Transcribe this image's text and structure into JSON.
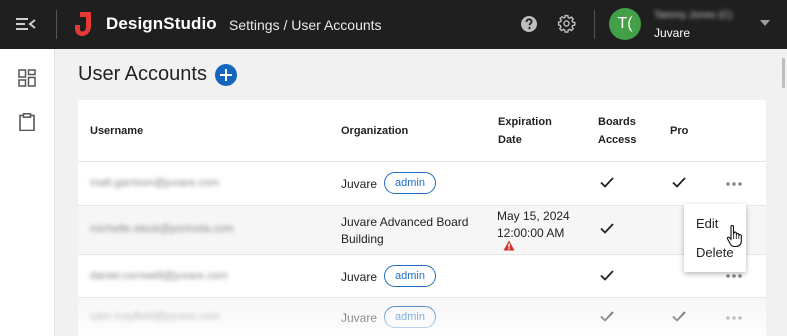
{
  "app": {
    "name": "DesignStudio"
  },
  "breadcrumb": {
    "parent": "Settings",
    "separator": " / ",
    "current": "User Accounts"
  },
  "user": {
    "initials": "T(",
    "name": "Tammy Jones (C)",
    "org": "Juvare"
  },
  "page": {
    "title": "User Accounts",
    "add_label": "Add user"
  },
  "table": {
    "headers": {
      "username": "Username",
      "organization": "Organization",
      "expiration_line1": "Expiration",
      "expiration_line2": "Date",
      "boards_line1": "Boards",
      "boards_line2": "Access",
      "pro": "Pro"
    },
    "rows": [
      {
        "username": "matt.garrison@juvare.com",
        "org": "Juvare",
        "badge": "admin",
        "expiration_date": "",
        "expiration_time": "",
        "boards": true,
        "pro": true
      },
      {
        "username": "michelle.steck@portnola.com",
        "org_line1": "Juvare Advanced Board",
        "org_line2": "Building",
        "badge": "",
        "expiration_date": "May 15, 2024",
        "expiration_time": "12:00:00 AM",
        "expired_warning": true,
        "boards": true,
        "pro": false
      },
      {
        "username": "daniel.cornwell@juvare.com",
        "org": "Juvare",
        "badge": "admin",
        "expiration_date": "",
        "expiration_time": "",
        "boards": true,
        "pro": false
      },
      {
        "username": "sam.mayfield@juvare.com",
        "org": "Juvare",
        "badge": "admin",
        "boards": true,
        "pro": true
      }
    ]
  },
  "context_menu": {
    "items": [
      "Edit",
      "Delete"
    ]
  },
  "colors": {
    "topbar": "#1f1f1f",
    "accent": "#1565c0",
    "avatar": "#43a047",
    "logo": "#e53935",
    "warning": "#d32f2f"
  }
}
